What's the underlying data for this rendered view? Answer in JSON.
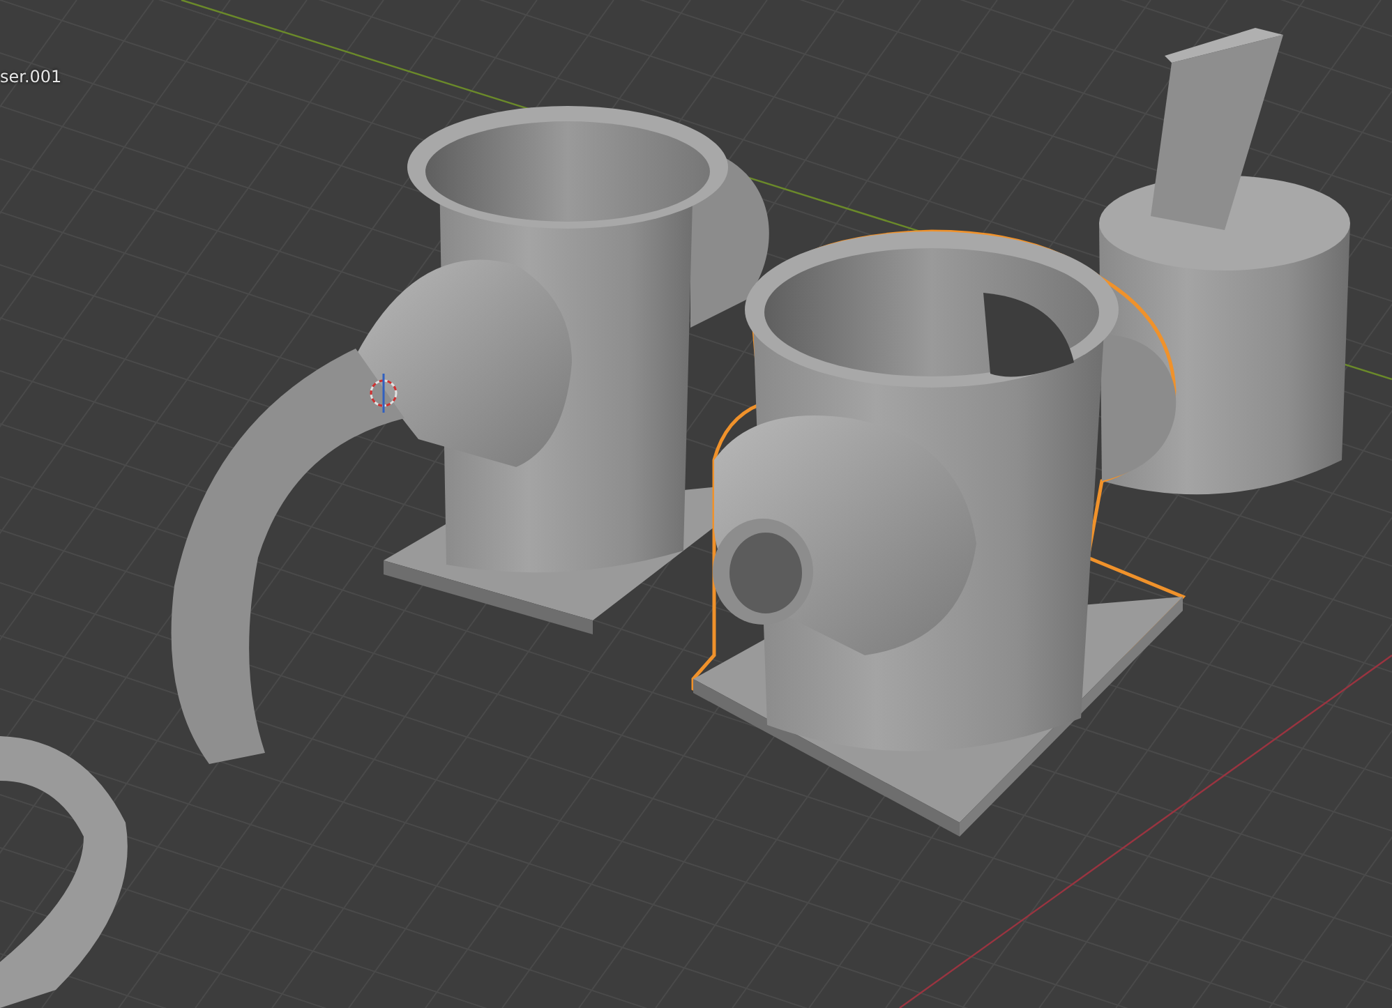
{
  "viewport": {
    "object_label": "ser.001",
    "objects": [
      {
        "kind": "ring",
        "selected": false
      },
      {
        "kind": "funnel-mug",
        "selected": false
      },
      {
        "kind": "cylinder",
        "selected": false
      },
      {
        "kind": "mug",
        "selected": true
      }
    ]
  }
}
